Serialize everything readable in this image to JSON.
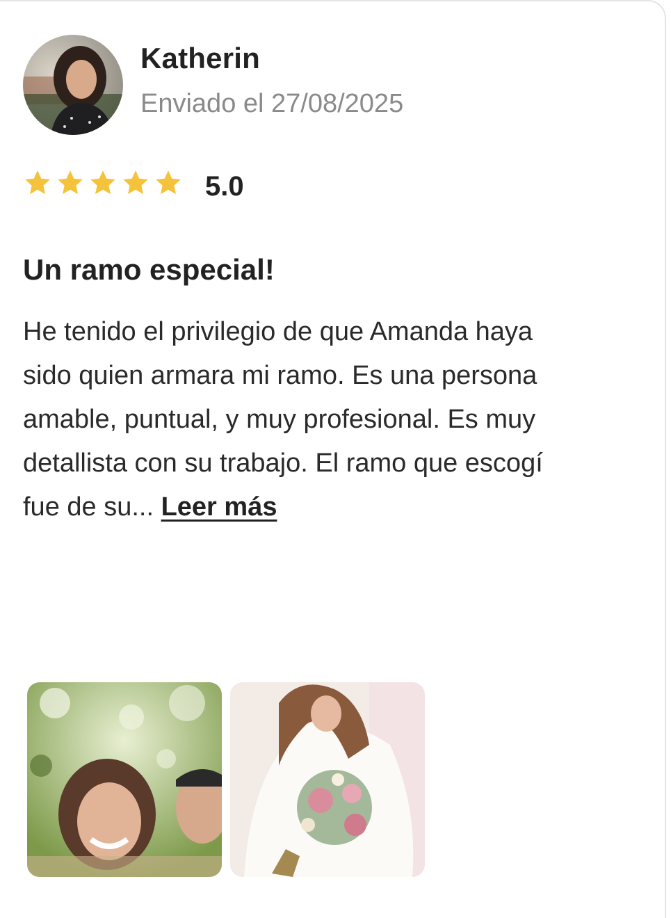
{
  "review": {
    "author_name": "Katherin",
    "sent_date": "Enviado el 27/08/2025",
    "rating": 5,
    "rating_label": "5.0",
    "title": "Un ramo especial!",
    "body_lines": [
      "He tenido el privilegio de que Amanda haya",
      "sido quien armara mi ramo. Es una persona",
      "amable, puntual, y muy profesional. Es muy",
      "detallista con su trabajo. El ramo que escogí",
      "fue de su..."
    ],
    "read_more_label": "Leer más",
    "photos": [
      {
        "icon": "couple-photo"
      },
      {
        "icon": "bride-bouquet-photo"
      }
    ]
  },
  "colors": {
    "star": "#F5C33B",
    "text": "#222222",
    "muted": "#8A8A8A"
  }
}
